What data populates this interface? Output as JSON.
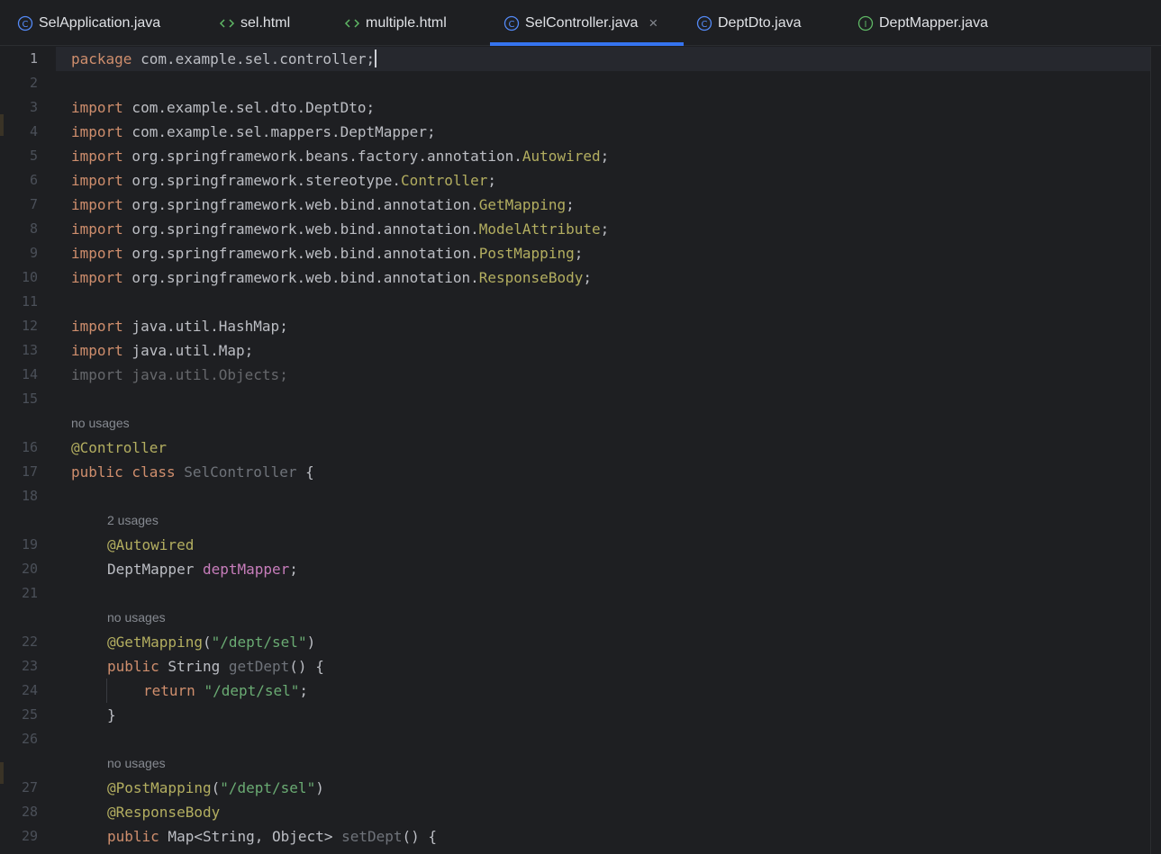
{
  "tabs": [
    {
      "label": "SelApplication.java",
      "icon": "class-icon",
      "active": false
    },
    {
      "label": "sel.html",
      "icon": "html-icon",
      "active": false
    },
    {
      "label": "multiple.html",
      "icon": "html-icon",
      "active": false
    },
    {
      "label": "SelController.java",
      "icon": "class-icon",
      "active": true
    },
    {
      "label": "DeptDto.java",
      "icon": "class-icon",
      "active": false
    },
    {
      "label": "DeptMapper.java",
      "icon": "interface-icon",
      "active": false
    }
  ],
  "tab_close_glyph": "×",
  "colors": {
    "background": "#1e1f22",
    "keyword": "#cf8e6d",
    "annotation": "#b3ae60",
    "string": "#6aab73",
    "field": "#c77dbb",
    "text": "#bcbec4",
    "line_number": "#4b5059",
    "accent": "#3574f0"
  },
  "current_line": 1,
  "hints": [
    {
      "before_line": 16,
      "text": "no usages"
    },
    {
      "before_line": 19,
      "text": "2 usages"
    },
    {
      "before_line": 22,
      "text": "no usages"
    },
    {
      "before_line": 27,
      "text": "no usages"
    }
  ],
  "lines": [
    {
      "n": "1",
      "tokens": [
        {
          "t": "package",
          "c": "kw"
        },
        {
          "t": " com.example.sel.controller;"
        }
      ]
    },
    {
      "n": "2",
      "tokens": []
    },
    {
      "n": "3",
      "tokens": [
        {
          "t": "import",
          "c": "kw"
        },
        {
          "t": " com.example.sel.dto.DeptDto;"
        }
      ]
    },
    {
      "n": "4",
      "tokens": [
        {
          "t": "import",
          "c": "kw"
        },
        {
          "t": " com.example.sel.mappers.DeptMapper;"
        }
      ]
    },
    {
      "n": "5",
      "tokens": [
        {
          "t": "import",
          "c": "kw"
        },
        {
          "t": " org.springframework.beans.factory.annotation."
        },
        {
          "t": "Autowired",
          "c": "an"
        },
        {
          "t": ";"
        }
      ]
    },
    {
      "n": "6",
      "tokens": [
        {
          "t": "import",
          "c": "kw"
        },
        {
          "t": " org.springframework.stereotype."
        },
        {
          "t": "Controller",
          "c": "an"
        },
        {
          "t": ";"
        }
      ]
    },
    {
      "n": "7",
      "tokens": [
        {
          "t": "import",
          "c": "kw"
        },
        {
          "t": " org.springframework.web.bind.annotation."
        },
        {
          "t": "GetMapping",
          "c": "an"
        },
        {
          "t": ";"
        }
      ]
    },
    {
      "n": "8",
      "tokens": [
        {
          "t": "import",
          "c": "kw"
        },
        {
          "t": " org.springframework.web.bind.annotation."
        },
        {
          "t": "ModelAttribute",
          "c": "an"
        },
        {
          "t": ";"
        }
      ]
    },
    {
      "n": "9",
      "tokens": [
        {
          "t": "import",
          "c": "kw"
        },
        {
          "t": " org.springframework.web.bind.annotation."
        },
        {
          "t": "PostMapping",
          "c": "an"
        },
        {
          "t": ";"
        }
      ]
    },
    {
      "n": "10",
      "tokens": [
        {
          "t": "import",
          "c": "kw"
        },
        {
          "t": " org.springframework.web.bind.annotation."
        },
        {
          "t": "ResponseBody",
          "c": "an"
        },
        {
          "t": ";"
        }
      ]
    },
    {
      "n": "11",
      "tokens": []
    },
    {
      "n": "12",
      "tokens": [
        {
          "t": "import",
          "c": "kw"
        },
        {
          "t": " java.util.HashMap;"
        }
      ]
    },
    {
      "n": "13",
      "tokens": [
        {
          "t": "import",
          "c": "kw"
        },
        {
          "t": " java.util.Map;"
        }
      ]
    },
    {
      "n": "14",
      "faded": true,
      "tokens": [
        {
          "t": "import java.util.Objects;"
        }
      ]
    },
    {
      "n": "15",
      "tokens": []
    },
    {
      "n": "16",
      "tokens": [
        {
          "t": "@Controller",
          "c": "an"
        }
      ]
    },
    {
      "n": "17",
      "tokens": [
        {
          "t": "public class",
          "c": "kw"
        },
        {
          "t": " "
        },
        {
          "t": "SelController",
          "c": "dim"
        },
        {
          "t": " {"
        }
      ]
    },
    {
      "n": "18",
      "tokens": []
    },
    {
      "n": "19",
      "indent": 1,
      "tokens": [
        {
          "t": "@Autowired",
          "c": "an"
        }
      ]
    },
    {
      "n": "20",
      "indent": 1,
      "tokens": [
        {
          "t": "DeptMapper "
        },
        {
          "t": "deptMapper",
          "c": "fld"
        },
        {
          "t": ";"
        }
      ]
    },
    {
      "n": "21",
      "tokens": []
    },
    {
      "n": "22",
      "indent": 1,
      "tokens": [
        {
          "t": "@GetMapping",
          "c": "an"
        },
        {
          "t": "("
        },
        {
          "t": "\"/dept/sel\"",
          "c": "str"
        },
        {
          "t": ")"
        }
      ]
    },
    {
      "n": "23",
      "indent": 1,
      "tokens": [
        {
          "t": "public",
          "c": "kw"
        },
        {
          "t": " String "
        },
        {
          "t": "getDept",
          "c": "dim"
        },
        {
          "t": "() {"
        }
      ]
    },
    {
      "n": "24",
      "indent": 2,
      "tokens": [
        {
          "t": "return",
          "c": "kw"
        },
        {
          "t": " "
        },
        {
          "t": "\"/dept/sel\"",
          "c": "str"
        },
        {
          "t": ";"
        }
      ]
    },
    {
      "n": "25",
      "indent": 1,
      "tokens": [
        {
          "t": "}"
        }
      ]
    },
    {
      "n": "26",
      "tokens": []
    },
    {
      "n": "27",
      "indent": 1,
      "tokens": [
        {
          "t": "@PostMapping",
          "c": "an"
        },
        {
          "t": "("
        },
        {
          "t": "\"/dept/sel\"",
          "c": "str"
        },
        {
          "t": ")"
        }
      ]
    },
    {
      "n": "28",
      "indent": 1,
      "tokens": [
        {
          "t": "@ResponseBody",
          "c": "an"
        }
      ]
    },
    {
      "n": "29",
      "indent": 1,
      "tokens": [
        {
          "t": "public",
          "c": "kw"
        },
        {
          "t": " Map<String, Object> "
        },
        {
          "t": "setDept",
          "c": "dim"
        },
        {
          "t": "() {"
        }
      ]
    }
  ]
}
